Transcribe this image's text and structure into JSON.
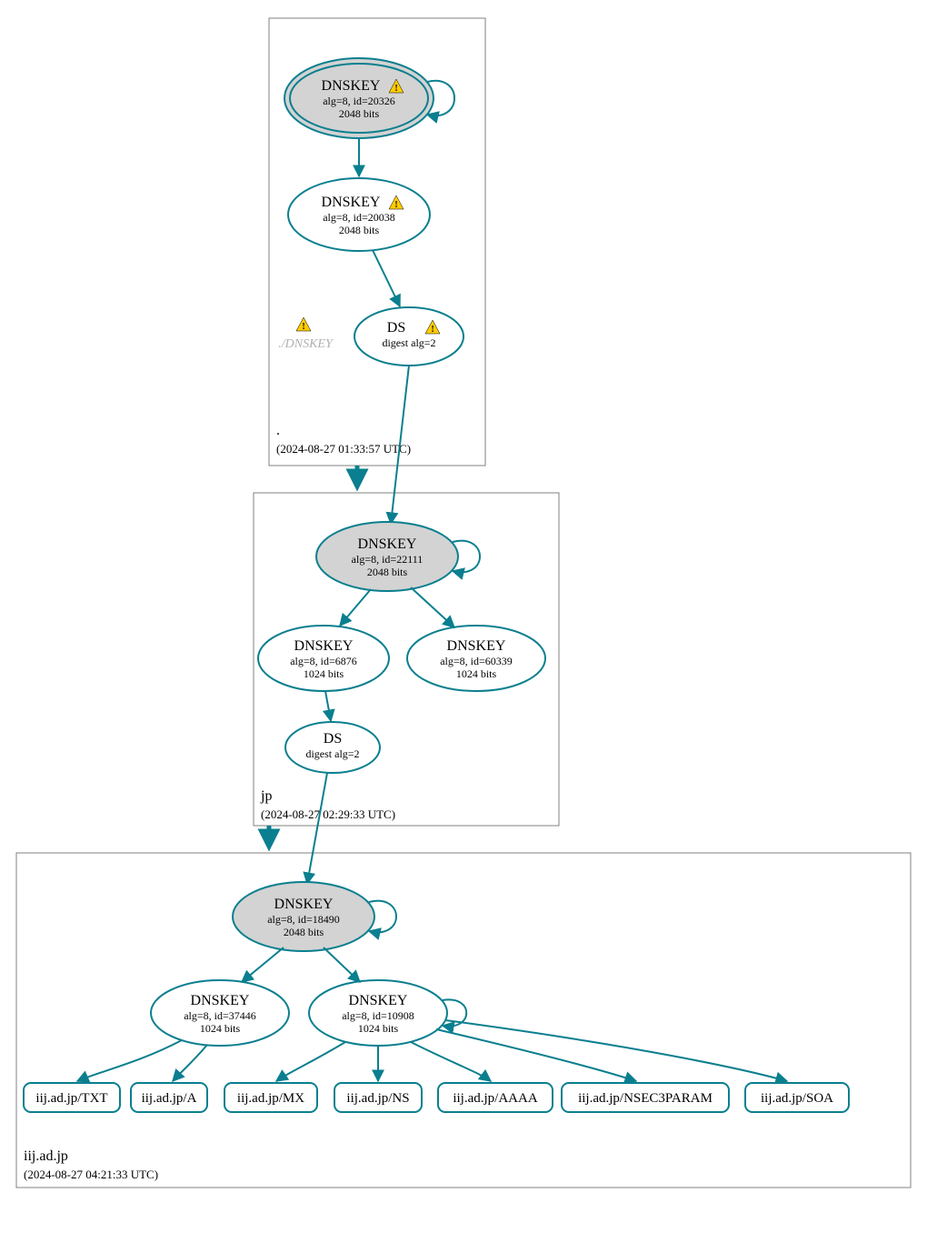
{
  "colors": {
    "teal": "#0a7f8f",
    "ksk_fill": "#d3d3d3"
  },
  "zones": {
    "root": {
      "label": ".",
      "timestamp": "(2024-08-27 01:33:57 UTC)",
      "nodes": {
        "ksk": {
          "title": "DNSKEY",
          "line1": "alg=8, id=20326",
          "line2": "2048 bits",
          "warning": true
        },
        "zsk": {
          "title": "DNSKEY",
          "line1": "alg=8, id=20038",
          "line2": "2048 bits",
          "warning": true
        },
        "placeholder": {
          "label": "./DNSKEY",
          "warning": true
        },
        "ds": {
          "title": "DS",
          "line1": "digest alg=2",
          "warning": true
        }
      }
    },
    "jp": {
      "label": "jp",
      "timestamp": "(2024-08-27 02:29:33 UTC)",
      "nodes": {
        "ksk": {
          "title": "DNSKEY",
          "line1": "alg=8, id=22111",
          "line2": "2048 bits"
        },
        "zsk1": {
          "title": "DNSKEY",
          "line1": "alg=8, id=6876",
          "line2": "1024 bits"
        },
        "zsk2": {
          "title": "DNSKEY",
          "line1": "alg=8, id=60339",
          "line2": "1024 bits"
        },
        "ds": {
          "title": "DS",
          "line1": "digest alg=2"
        }
      }
    },
    "iij": {
      "label": "iij.ad.jp",
      "timestamp": "(2024-08-27 04:21:33 UTC)",
      "nodes": {
        "ksk": {
          "title": "DNSKEY",
          "line1": "alg=8, id=18490",
          "line2": "2048 bits"
        },
        "zsk1": {
          "title": "DNSKEY",
          "line1": "alg=8, id=37446",
          "line2": "1024 bits"
        },
        "zsk2": {
          "title": "DNSKEY",
          "line1": "alg=8, id=10908",
          "line2": "1024 bits"
        }
      },
      "records": [
        "iij.ad.jp/TXT",
        "iij.ad.jp/A",
        "iij.ad.jp/MX",
        "iij.ad.jp/NS",
        "iij.ad.jp/AAAA",
        "iij.ad.jp/NSEC3PARAM",
        "iij.ad.jp/SOA"
      ]
    }
  }
}
